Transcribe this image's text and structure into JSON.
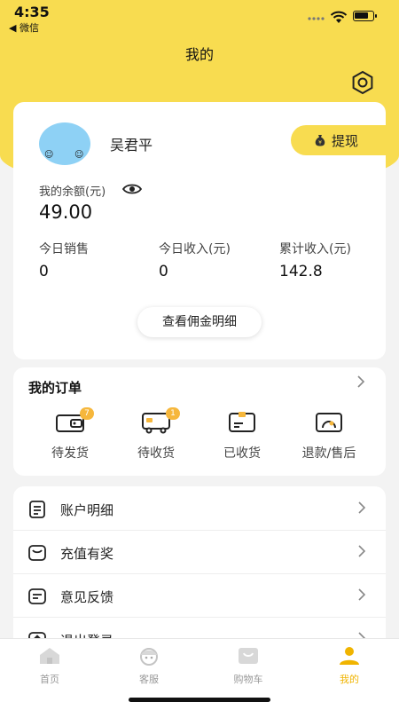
{
  "status": {
    "time": "4:35",
    "back_app": "◀ 微信"
  },
  "nav": {
    "title": "我的"
  },
  "profile": {
    "username": "吴君平",
    "withdraw_label": "提现",
    "balance_label": "我的余额(元)",
    "balance_value": "49.00",
    "stats": [
      {
        "label": "今日销售",
        "value": "0"
      },
      {
        "label": "今日收入(元)",
        "value": "0"
      },
      {
        "label": "累计收入(元)",
        "value": "142.8"
      }
    ],
    "commission_button": "查看佣金明细"
  },
  "orders": {
    "title": "我的订单",
    "items": [
      {
        "label": "待发货",
        "badge": "7",
        "icon": "wallet-icon"
      },
      {
        "label": "待收货",
        "badge": "1",
        "icon": "truck-icon"
      },
      {
        "label": "已收货",
        "badge": "",
        "icon": "card-icon"
      },
      {
        "label": "退款/售后",
        "badge": "",
        "icon": "refund-icon"
      }
    ]
  },
  "menu": {
    "items": [
      {
        "label": "账户明细",
        "icon": "account-detail-icon"
      },
      {
        "label": "充值有奖",
        "icon": "recharge-icon"
      },
      {
        "label": "意见反馈",
        "icon": "feedback-icon"
      },
      {
        "label": "退出登录",
        "icon": "logout-icon"
      }
    ]
  },
  "tabbar": {
    "items": [
      {
        "label": "首页",
        "icon": "home-icon"
      },
      {
        "label": "客服",
        "icon": "service-icon"
      },
      {
        "label": "购物车",
        "icon": "cart-icon"
      },
      {
        "label": "我的",
        "icon": "person-icon",
        "active": true
      }
    ]
  },
  "colors": {
    "brand_yellow": "#f8dc50",
    "badge": "#f6b73c",
    "active_tab": "#f0b400"
  }
}
